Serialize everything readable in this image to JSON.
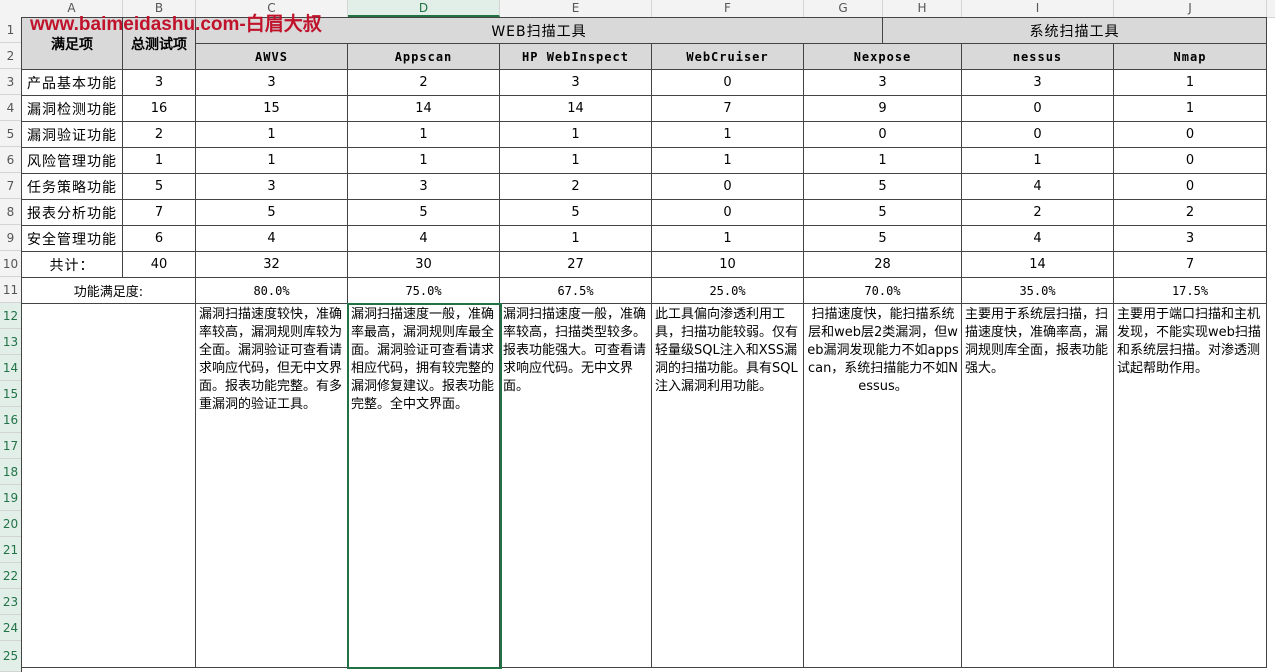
{
  "columns": [
    "A",
    "B",
    "C",
    "D",
    "E",
    "F",
    "G",
    "H",
    "I",
    "J"
  ],
  "rows": [
    "1",
    "2",
    "3",
    "4",
    "5",
    "6",
    "7",
    "8",
    "9",
    "10",
    "11",
    "12",
    "13",
    "14",
    "15",
    "16",
    "17",
    "18",
    "19",
    "20",
    "21",
    "22",
    "23",
    "24",
    "25"
  ],
  "watermark": "www.baimeidashu.com-白眉大叔",
  "header": {
    "requirement": "满足项",
    "total_tests": "总测试项",
    "web_group": "WEB扫描工具",
    "sys_group": "系统扫描工具",
    "tools": [
      "AWVS",
      "Appscan",
      "HP WebInspect",
      "WebCruiser",
      "Nexpose",
      "nessus",
      "Nmap"
    ]
  },
  "table_rows": [
    {
      "label": "产品基本功能",
      "total": "3",
      "values": [
        "3",
        "2",
        "3",
        "0",
        "3",
        "3",
        "1"
      ]
    },
    {
      "label": "漏洞检测功能",
      "total": "16",
      "values": [
        "15",
        "14",
        "14",
        "7",
        "9",
        "0",
        "1"
      ]
    },
    {
      "label": "漏洞验证功能",
      "total": "2",
      "values": [
        "1",
        "1",
        "1",
        "1",
        "0",
        "0",
        "0"
      ]
    },
    {
      "label": "风险管理功能",
      "total": "1",
      "values": [
        "1",
        "1",
        "1",
        "1",
        "1",
        "1",
        "0"
      ]
    },
    {
      "label": "任务策略功能",
      "total": "5",
      "values": [
        "3",
        "3",
        "2",
        "0",
        "5",
        "4",
        "0"
      ]
    },
    {
      "label": "报表分析功能",
      "total": "7",
      "values": [
        "5",
        "5",
        "5",
        "0",
        "5",
        "2",
        "2"
      ]
    },
    {
      "label": "安全管理功能",
      "total": "6",
      "values": [
        "4",
        "4",
        "1",
        "1",
        "5",
        "4",
        "3"
      ]
    },
    {
      "label": "共计：",
      "total": "40",
      "values": [
        "32",
        "30",
        "27",
        "10",
        "28",
        "14",
        "7"
      ]
    }
  ],
  "satisfaction": {
    "label": "功能满足度:",
    "values": [
      "80.0%",
      "75.0%",
      "67.5%",
      "25.0%",
      "70.0%",
      "35.0%",
      "17.5%"
    ]
  },
  "descriptions": [
    "漏洞扫描速度较快，准确率较高，漏洞规则库较为全面。漏洞验证可查看请求响应代码，但无中文界面。报表功能完整。有多重漏洞的验证工具。",
    "漏洞扫描速度一般，准确率最高，漏洞规则库最全面。漏洞验证可查看请求相应代码，拥有较完整的漏洞修复建议。报表功能完整。全中文界面。",
    "漏洞扫描速度一般，准确率较高，扫描类型较多。报表功能强大。可查看请求响应代码。无中文界面。",
    "此工具偏向渗透利用工具，扫描功能较弱。仅有轻量级SQL注入和XSS漏洞的扫描功能。具有SQL注入漏洞利用功能。",
    "扫描速度快，能扫描系统层和web层2类漏洞，但web漏洞发现能力不如appscan，系统扫描能力不如Nessus。",
    "主要用于系统层扫描，扫描速度快，准确率高，漏洞规则库全面，报表功能强大。",
    "主要用于端口扫描和主机发现，不能实现web扫描和系统层扫描。对渗透测试起帮助作用。"
  ]
}
